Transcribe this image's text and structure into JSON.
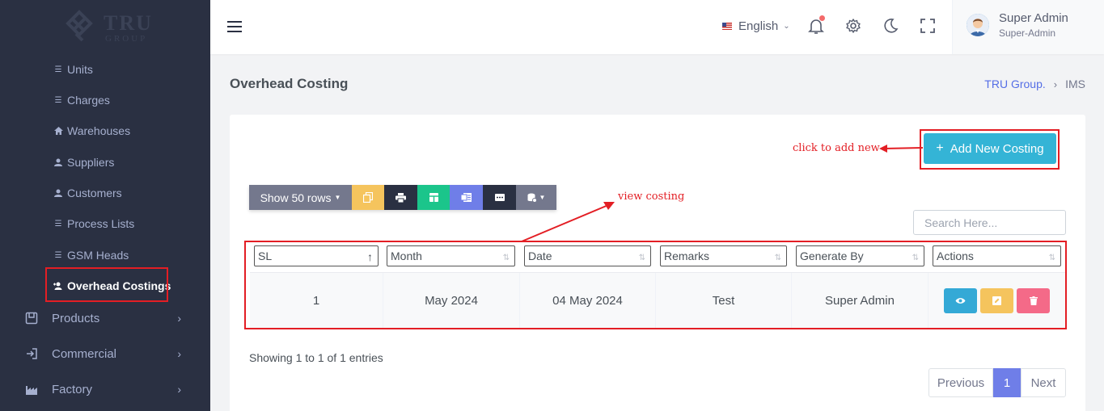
{
  "brand": {
    "name": "TRU",
    "sub": "GROUP"
  },
  "sidebar": {
    "sub_items": [
      {
        "label": "Units",
        "icon": "list-icon"
      },
      {
        "label": "Charges",
        "icon": "list-icon"
      },
      {
        "label": "Warehouses",
        "icon": "home-icon"
      },
      {
        "label": "Suppliers",
        "icon": "user-icon"
      },
      {
        "label": "Customers",
        "icon": "user-icon"
      },
      {
        "label": "Process Lists",
        "icon": "list-icon"
      },
      {
        "label": "GSM Heads",
        "icon": "list-icon"
      },
      {
        "label": "Overhead Costings",
        "icon": "user-plus-icon",
        "active": true
      }
    ],
    "main_items": [
      {
        "label": "Products",
        "icon": "box-icon"
      },
      {
        "label": "Commercial",
        "icon": "login-icon"
      },
      {
        "label": "Factory",
        "icon": "factory-icon"
      }
    ]
  },
  "header": {
    "language": "English",
    "user_name": "Super Admin",
    "user_role": "Super-Admin"
  },
  "page": {
    "title": "Overhead Costing",
    "breadcrumb": [
      "TRU Group.",
      "IMS"
    ]
  },
  "toolbar": {
    "add_button": "Add New Costing",
    "show_rows": "Show 50 rows",
    "search_placeholder": "Search Here...",
    "export_buttons": [
      {
        "name": "copy-icon",
        "color": "#f5c45d"
      },
      {
        "name": "print-icon",
        "color": "#2a3042"
      },
      {
        "name": "excel-icon",
        "color": "#1bc58b"
      },
      {
        "name": "word-icon",
        "color": "#6f7ee8"
      },
      {
        "name": "csv-icon",
        "color": "#2a3042"
      },
      {
        "name": "column-visibility-icon",
        "color": "#74788d"
      }
    ]
  },
  "annotations": {
    "add_new": "click to add new",
    "view": "view costing"
  },
  "table": {
    "columns": [
      "SL",
      "Month",
      "Date",
      "Remarks",
      "Generate By",
      "Actions"
    ],
    "rows": [
      {
        "sl": "1",
        "month": "May 2024",
        "date": "04 May 2024",
        "remarks": "Test",
        "generate_by": "Super Admin"
      }
    ]
  },
  "footer": {
    "info": "Showing 1 to 1 of 1 entries",
    "pagination": {
      "prev": "Previous",
      "current": "1",
      "next": "Next"
    }
  },
  "colors": {
    "sidebar_bg": "#2a3042",
    "accent": "#556ee6",
    "add_button": "#34b4d6",
    "annotation_red": "#e31e24"
  }
}
